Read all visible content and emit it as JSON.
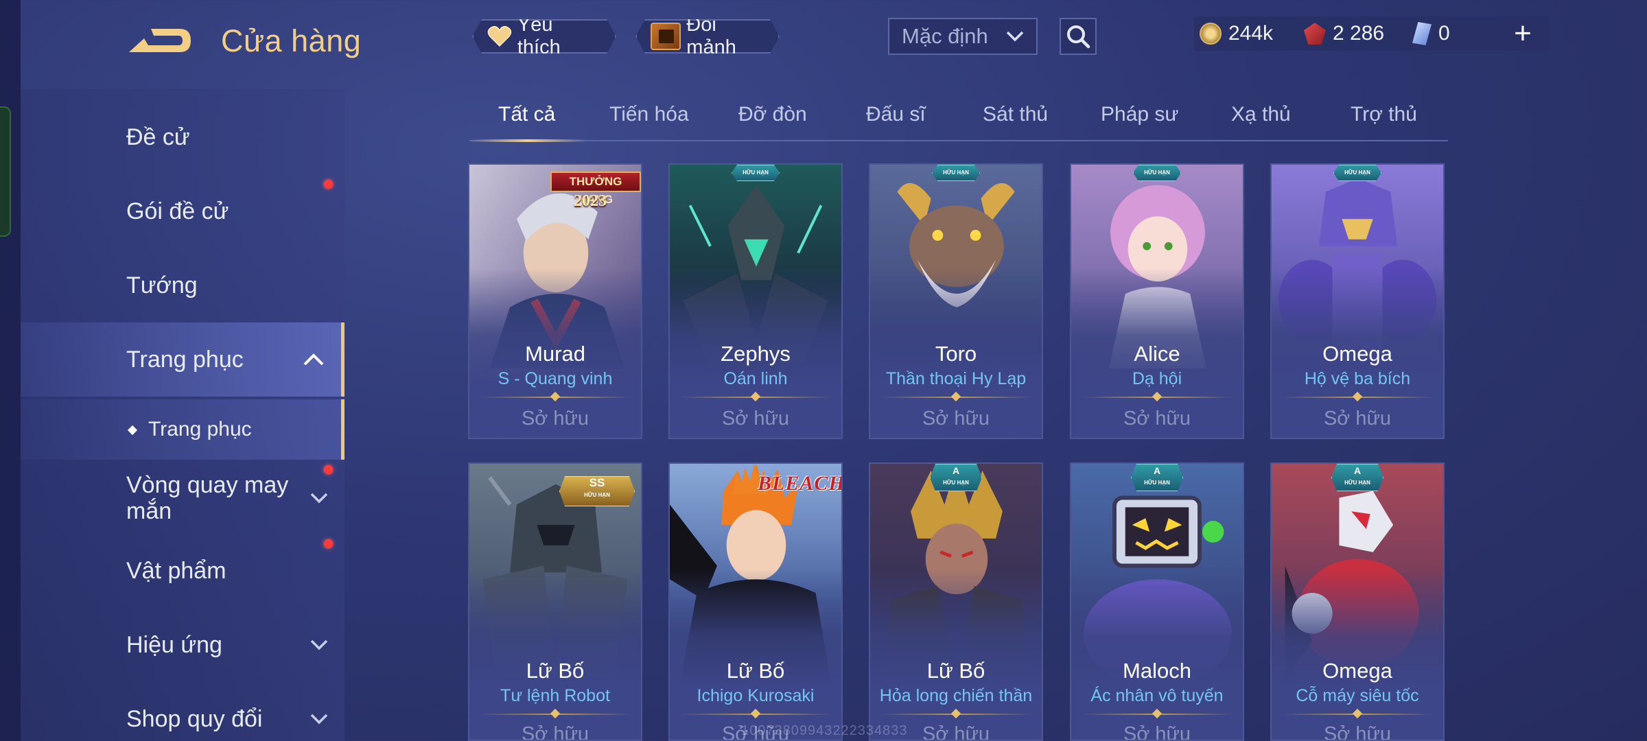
{
  "header": {
    "title": "Cửa hàng",
    "favorites_label": "Yêu thích",
    "fragments_label": "Đổi mảnh",
    "sort_value": "Mặc định"
  },
  "currency": [
    {
      "icon": "gold-coin-icon",
      "value": "244k"
    },
    {
      "icon": "ruby-icon",
      "value": "2 286"
    },
    {
      "icon": "crystal-icon",
      "value": "0"
    }
  ],
  "sidebar": {
    "items": [
      {
        "label": "Đề cử"
      },
      {
        "label": "Gói đề cử"
      },
      {
        "label": "Tướng"
      },
      {
        "label": "Trang phục"
      },
      {
        "label": "Trang phục"
      },
      {
        "label": "Vòng quay may mắn"
      },
      {
        "label": "Vật phẩm"
      },
      {
        "label": "Hiệu ứng"
      },
      {
        "label": "Shop quy đổi"
      }
    ]
  },
  "tabs": [
    {
      "label": "Tất cả"
    },
    {
      "label": "Tiến hóa"
    },
    {
      "label": "Đỡ đòn"
    },
    {
      "label": "Đấu sĩ"
    },
    {
      "label": "Sát thủ"
    },
    {
      "label": "Pháp sư"
    },
    {
      "label": "Xạ thủ"
    },
    {
      "label": "Trợ thủ"
    }
  ],
  "cards": [
    {
      "hero": "Murad",
      "skin": "S - Quang vinh",
      "status": "Sở hữu",
      "event_line1": "THƯỞNG HẠNG",
      "event_year": "2023"
    },
    {
      "hero": "Zephys",
      "skin": "Oán linh",
      "status": "Sở hữu",
      "badge": "HỮU HẠN"
    },
    {
      "hero": "Toro",
      "skin": "Thần thoại Hy Lạp",
      "status": "Sở hữu",
      "badge": "HỮU HẠN"
    },
    {
      "hero": "Alice",
      "skin": "Dạ hội",
      "status": "Sở hữu",
      "badge": "HỮU HẠN"
    },
    {
      "hero": "Omega",
      "skin": "Hộ vệ ba bích",
      "status": "Sở hữu",
      "badge": "HỮU HẠN"
    },
    {
      "hero": "Lữ Bố",
      "skin": "Tư lệnh Robot",
      "status": "Sở hữu",
      "tier": "SS",
      "badge": "HỮU HẠN"
    },
    {
      "hero": "Lữ Bố",
      "skin": "Ichigo Kurosaki",
      "status": "Sở hữu",
      "logo": "BLEACH"
    },
    {
      "hero": "Lữ Bố",
      "skin": "Hỏa long chiến thần",
      "status": "Sở hữu",
      "tier": "A",
      "badge": "HỮU HẠN"
    },
    {
      "hero": "Maloch",
      "skin": "Ác nhân vô tuyến",
      "status": "Sở hữu",
      "tier": "A",
      "badge": "HỮU HẠN"
    },
    {
      "hero": "Omega",
      "skin": "Cỗ máy siêu tốc",
      "status": "Sở hữu",
      "tier": "A",
      "badge": "HỮU HẠN"
    }
  ],
  "watermark": "10073809943222334833",
  "colors": {
    "accent_gold": "#f3cf86",
    "skin_name": "#74c6f2",
    "notification_dot": "#ff3b3b"
  }
}
